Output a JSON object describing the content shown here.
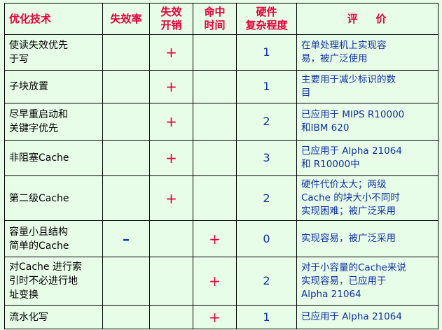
{
  "headers": {
    "technique": "优化技术",
    "miss_rate": "失效率",
    "miss_penalty": "失效\n开销",
    "hit_time": "命中\n时间",
    "hw_complexity": "硬件\n复杂程度",
    "evaluation": "评价"
  },
  "rows": [
    {
      "technique": "使读失效优先\n于写",
      "miss_rate": "",
      "miss_penalty": "+",
      "hit_time": "",
      "complexity": "1",
      "evaluation": "在单处理机上实现容\n易，被广泛使用"
    },
    {
      "technique": "子块放置",
      "miss_rate": "",
      "miss_penalty": "+",
      "hit_time": "",
      "complexity": "1",
      "evaluation": "主要用于减少标识的数\n目"
    },
    {
      "technique": "尽早重启动和\n关键字优先",
      "miss_rate": "",
      "miss_penalty": "+",
      "hit_time": "",
      "complexity": "2",
      "evaluation": "已应用于 MIPS R10000\n和IBM 620"
    },
    {
      "technique": "非阻塞Cache",
      "miss_rate": "",
      "miss_penalty": "+",
      "hit_time": "",
      "complexity": "3",
      "evaluation": "已应用于 Alpha 21064\n和 R10000中"
    },
    {
      "technique": "第二级Cache",
      "miss_rate": "",
      "miss_penalty": "+",
      "hit_time": "",
      "complexity": "2",
      "evaluation": "硬件代价太大；两级\nCache 的块大小不同时\n实现困难；被广泛采用"
    },
    {
      "technique": "容量小且结构\n简单的Cache",
      "miss_rate": "–",
      "miss_penalty": "",
      "hit_time": "+",
      "complexity": "0",
      "evaluation": "实现容易，被广泛采用"
    },
    {
      "technique": "对Cache 进行索\n引时不必进行地\n址变换",
      "miss_rate": "",
      "miss_penalty": "",
      "hit_time": "+",
      "complexity": "2",
      "evaluation": "对于小容量的Cache来说\n实现容易，已应用于\nAlpha 21064"
    },
    {
      "technique": "流水化写",
      "miss_rate": "",
      "miss_penalty": "",
      "hit_time": "+",
      "complexity": "1",
      "evaluation": "已应用于 Alpha 21064"
    }
  ]
}
